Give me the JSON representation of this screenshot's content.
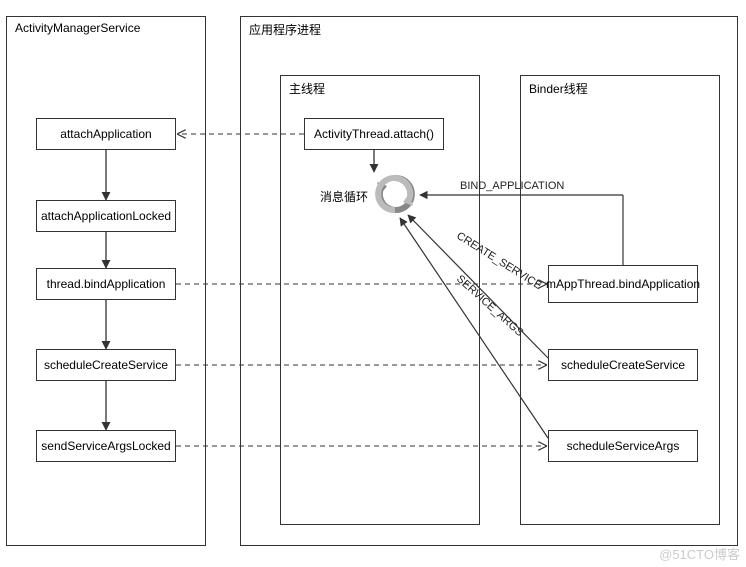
{
  "ams": {
    "title": "ActivityManagerService",
    "nodes": {
      "attachApplication": "attachApplication",
      "attachApplicationLocked": "attachApplicationLocked",
      "threadBindApplication": "thread.bindApplication",
      "scheduleCreateService": "scheduleCreateService",
      "sendServiceArgsLocked": "sendServiceArgsLocked"
    }
  },
  "app_process": {
    "title": "应用程序进程",
    "main_thread": {
      "title": "主线程",
      "attach_node": "ActivityThread.attach()",
      "msg_loop": "消息循环"
    },
    "binder_thread": {
      "title": "Binder线程",
      "nodes": {
        "bindApplication": "mAppThread.bindApplication",
        "scheduleCreateService": "scheduleCreateService",
        "scheduleServiceArgs": "scheduleServiceArgs"
      }
    }
  },
  "edge_labels": {
    "bind_application": "BIND_APPLICATION",
    "create_service": "CREATE_SERVICE",
    "service_args": "SERVICE_ARGS"
  },
  "watermark": "@51CTO博客"
}
